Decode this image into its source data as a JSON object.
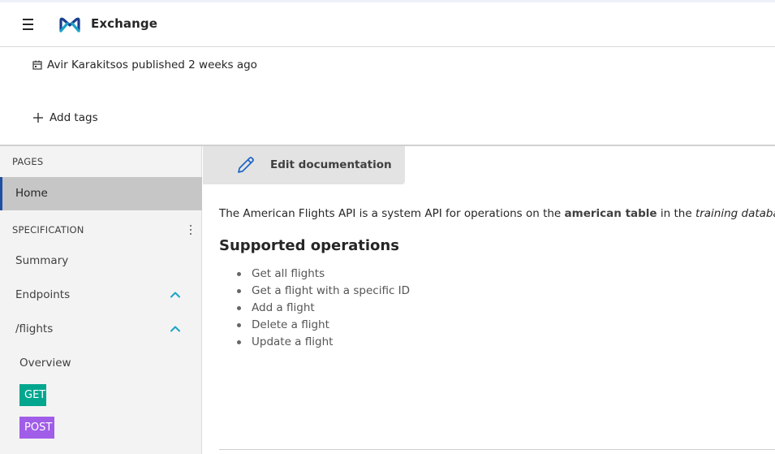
{
  "header": {
    "app_title": "Exchange",
    "menu_icon": "hamburger-menu-icon",
    "logo_icon": "mulesoft-logo-icon"
  },
  "meta": {
    "published_text": "Avir Karakitsos published 2 weeks ago",
    "add_tags_label": "Add tags"
  },
  "sidebar": {
    "pages_label": "PAGES",
    "home_label": "Home",
    "specification_label": "SPECIFICATION",
    "items": [
      {
        "label": "Summary"
      },
      {
        "label": "Endpoints"
      },
      {
        "label": "/flights"
      }
    ],
    "sub_items": [
      {
        "label": "Overview"
      },
      {
        "label": "GET"
      },
      {
        "label": "POST"
      }
    ]
  },
  "main": {
    "edit_label": "Edit documentation",
    "intro_pre": "The American Flights API is a system API for operations on the ",
    "intro_bold": "american table",
    "intro_mid": " in the ",
    "intro_italic": "training database",
    "intro_end": ".",
    "ops_title": "Supported operations",
    "ops": [
      "Get all flights",
      "Get a flight with a specific ID",
      "Add a flight",
      "Delete a flight",
      "Update a flight"
    ]
  },
  "colors": {
    "accent": "#1f4fa0",
    "chevron": "#1aa3c8",
    "get_badge": "#00a68e",
    "post_badge": "#a05de8"
  }
}
